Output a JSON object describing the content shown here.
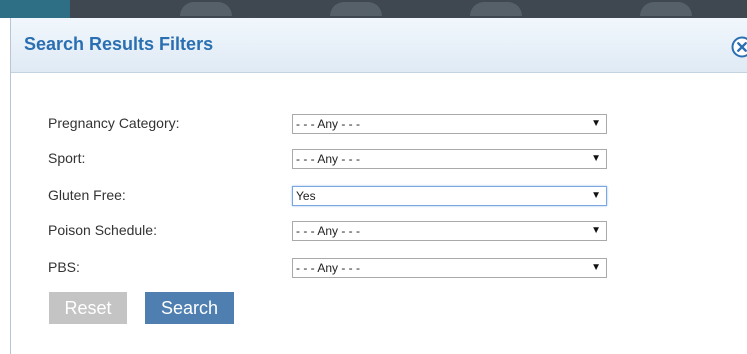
{
  "dialog": {
    "title": "Search Results Filters",
    "close_icon": "close-circle-icon"
  },
  "filters": [
    {
      "label": "Pregnancy Category:",
      "value": "- - - Any - - -"
    },
    {
      "label": "Sport:",
      "value": "- - - Any - - -"
    },
    {
      "label": "Gluten Free:",
      "value": "Yes"
    },
    {
      "label": "Poison Schedule:",
      "value": "- - - Any - - -"
    },
    {
      "label": "PBS:",
      "value": "- - - Any - - -"
    }
  ],
  "buttons": {
    "reset_label": "Reset",
    "search_label": "Search"
  },
  "colors": {
    "title": "#2a6fb2",
    "search_button": "#4e7fb0",
    "reset_button": "#c4c4c4"
  }
}
